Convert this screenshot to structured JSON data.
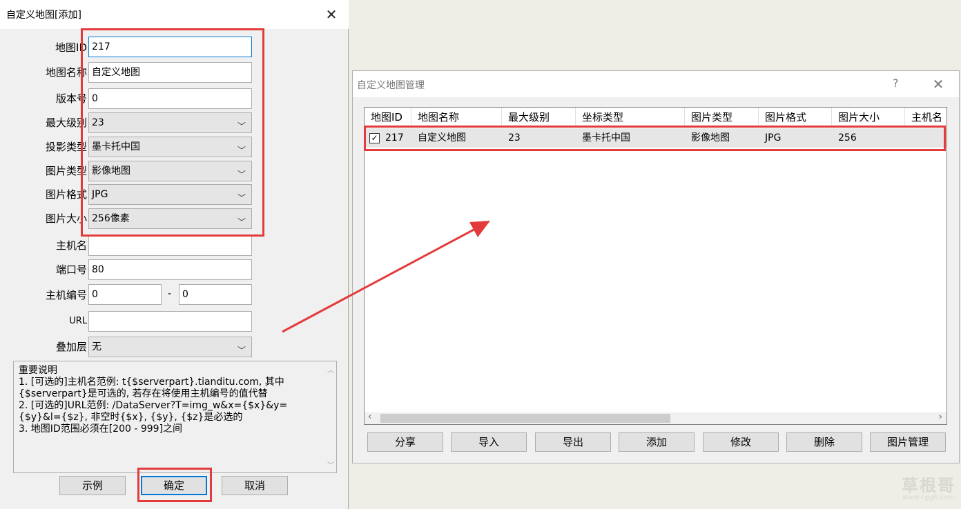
{
  "add_dialog": {
    "title": "自定义地图[添加]",
    "close_glyph": "✕",
    "fields": {
      "map_id": {
        "label": "地图ID",
        "value": "217"
      },
      "map_name": {
        "label": "地图名称",
        "value": "自定义地图"
      },
      "version": {
        "label": "版本号",
        "value": "0"
      },
      "max_level": {
        "label": "最大级别",
        "value": "23"
      },
      "projection": {
        "label": "投影类型",
        "value": "墨卡托中国"
      },
      "image_type": {
        "label": "图片类型",
        "value": "影像地图"
      },
      "image_format": {
        "label": "图片格式",
        "value": "JPG"
      },
      "image_size": {
        "label": "图片大小",
        "value": "256像素"
      },
      "host": {
        "label": "主机名",
        "value": ""
      },
      "port": {
        "label": "端口号",
        "value": "80"
      },
      "host_no": {
        "label": "主机编号",
        "from": "0",
        "sep": "-",
        "to": "0"
      },
      "url": {
        "label": "URL",
        "value": ""
      },
      "overlay": {
        "label": "叠加层",
        "value": "无"
      }
    },
    "notes": [
      "重要说明",
      "1. [可选的]主机名范例: t{$serverpart}.tianditu.com, 其中{$serverpart}是可选的, 若存在将使用主机编号的值代替",
      "2. [可选的]URL范例: /DataServer?T=img_w&x={$x}&y={$y}&l={$z}, 非空时{$x}, {$y}, {$z}是必选的",
      "3. 地图ID范围必须在[200 - 999]之间"
    ],
    "buttons": {
      "example": "示例",
      "ok": "确定",
      "cancel": "取消"
    }
  },
  "manager_dialog": {
    "title": "自定义地图管理",
    "help_glyph": "?",
    "close_glyph": "✕",
    "columns": [
      "地图ID",
      "地图名称",
      "最大级别",
      "坐标类型",
      "图片类型",
      "图片格式",
      "图片大小",
      "主机名"
    ],
    "row": {
      "checked": "☑",
      "id": "217",
      "name": "自定义地图",
      "max_level": "23",
      "coord": "墨卡托中国",
      "img_type": "影像地图",
      "img_format": "JPG",
      "img_size": "256",
      "host": ""
    },
    "buttons": [
      "分享",
      "导入",
      "导出",
      "添加",
      "修改",
      "删除",
      "图片管理"
    ]
  },
  "watermark": {
    "main": "草根哥",
    "sub": "www.cgg6.com"
  },
  "colors": {
    "annotation": "#e33b3b",
    "focus": "#0078d7"
  }
}
